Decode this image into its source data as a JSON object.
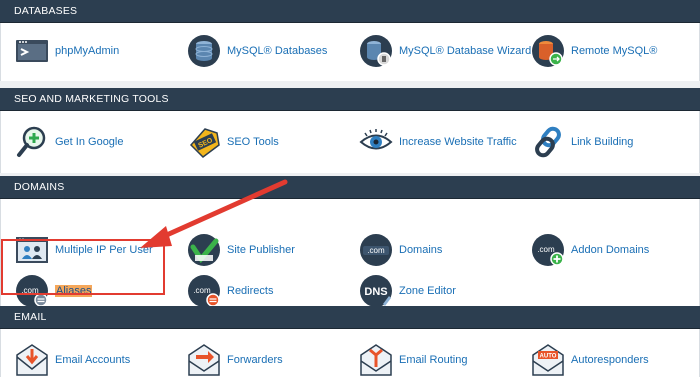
{
  "sections": {
    "databases": {
      "title": "DATABASES",
      "items": [
        "phpMyAdmin",
        "MySQL® Databases",
        "MySQL® Database Wizard",
        "Remote MySQL®"
      ]
    },
    "seo": {
      "title": "SEO AND MARKETING TOOLS",
      "items": [
        "Get In Google",
        "SEO Tools",
        "Increase Website Traffic",
        "Link Building"
      ]
    },
    "domains": {
      "title": "DOMAINS",
      "items": [
        "Multiple IP Per User",
        "Site Publisher",
        "Domains",
        "Addon Domains",
        "Aliases",
        "Redirects",
        "Zone Editor"
      ]
    },
    "email": {
      "title": "EMAIL",
      "items": [
        "Email Accounts",
        "Forwarders",
        "Email Routing",
        "Autoresponders"
      ]
    }
  },
  "icon_text": {
    "dotcom": ".com",
    "seo": "SEO",
    "dns": "DNS",
    "auto": "AUTO"
  },
  "colors": {
    "header_bg": "#2c3e50",
    "link": "#1a6fb5",
    "annotation_red": "#e23b30",
    "highlight": "#f5a75a"
  },
  "icons": [
    "phpmyadmin-icon",
    "database-icon",
    "database-wizard-icon",
    "remote-mysql-icon",
    "magnifier-plus-icon",
    "seo-tag-icon",
    "eye-icon",
    "chain-link-icon",
    "users-network-icon",
    "site-publisher-icon",
    "dotcom-globe-icon",
    "addon-domain-icon",
    "alias-icon",
    "redirect-icon",
    "dns-icon",
    "email-download-icon",
    "email-forward-icon",
    "email-routing-icon",
    "autoresponder-icon"
  ]
}
